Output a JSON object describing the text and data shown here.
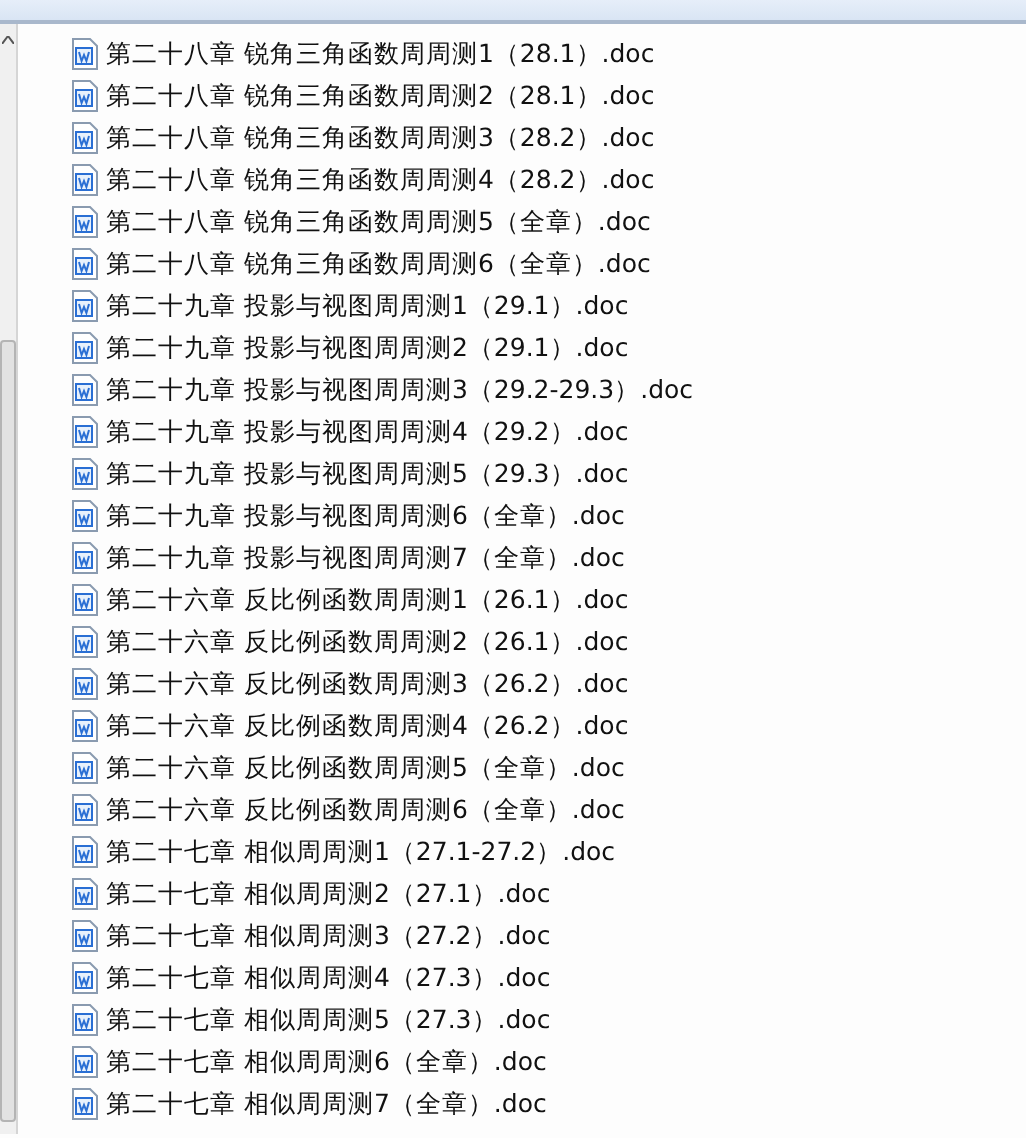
{
  "files": [
    {
      "name": "第二十八章 锐角三角函数周周测1（28.1）.doc"
    },
    {
      "name": "第二十八章 锐角三角函数周周测2（28.1）.doc"
    },
    {
      "name": "第二十八章 锐角三角函数周周测3（28.2）.doc"
    },
    {
      "name": "第二十八章 锐角三角函数周周测4（28.2）.doc"
    },
    {
      "name": "第二十八章 锐角三角函数周周测5（全章）.doc"
    },
    {
      "name": "第二十八章 锐角三角函数周周测6（全章）.doc"
    },
    {
      "name": "第二十九章 投影与视图周周测1（29.1）.doc"
    },
    {
      "name": "第二十九章 投影与视图周周测2（29.1）.doc"
    },
    {
      "name": "第二十九章 投影与视图周周测3（29.2-29.3）.doc"
    },
    {
      "name": "第二十九章 投影与视图周周测4（29.2）.doc"
    },
    {
      "name": "第二十九章 投影与视图周周测5（29.3）.doc"
    },
    {
      "name": "第二十九章 投影与视图周周测6（全章）.doc"
    },
    {
      "name": "第二十九章 投影与视图周周测7（全章）.doc"
    },
    {
      "name": "第二十六章 反比例函数周周测1（26.1）.doc"
    },
    {
      "name": "第二十六章 反比例函数周周测2（26.1）.doc"
    },
    {
      "name": "第二十六章 反比例函数周周测3（26.2）.doc"
    },
    {
      "name": "第二十六章 反比例函数周周测4（26.2）.doc"
    },
    {
      "name": "第二十六章 反比例函数周周测5（全章）.doc"
    },
    {
      "name": "第二十六章 反比例函数周周测6（全章）.doc"
    },
    {
      "name": "第二十七章 相似周周测1（27.1-27.2）.doc"
    },
    {
      "name": "第二十七章 相似周周测2（27.1）.doc"
    },
    {
      "name": "第二十七章 相似周周测3（27.2）.doc"
    },
    {
      "name": "第二十七章 相似周周测4（27.3）.doc"
    },
    {
      "name": "第二十七章 相似周周测5（27.3）.doc"
    },
    {
      "name": "第二十七章 相似周周测6（全章）.doc"
    },
    {
      "name": "第二十七章 相似周周测7（全章）.doc"
    }
  ]
}
